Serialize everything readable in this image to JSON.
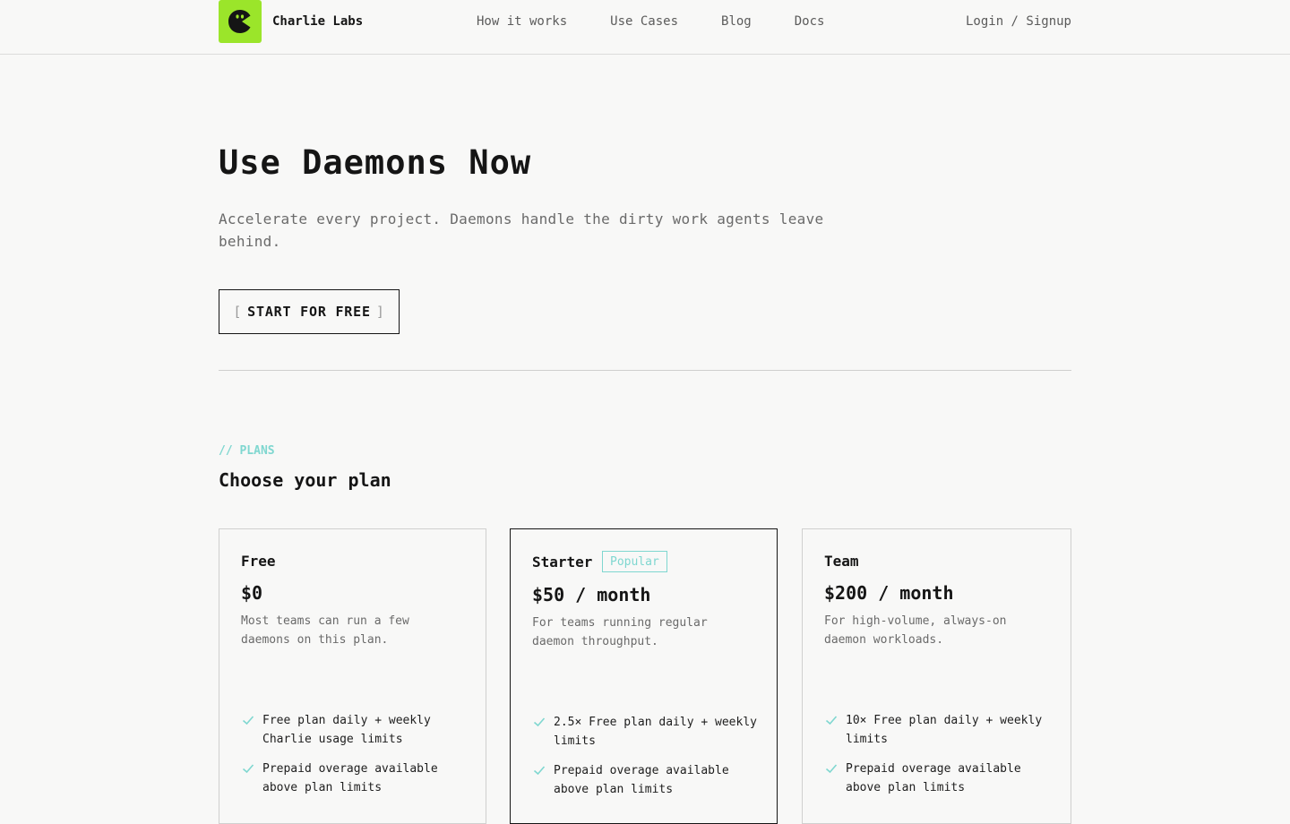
{
  "header": {
    "brand": "Charlie Labs",
    "logo_icon": "charlie-mascot-icon",
    "accent": "#9be52a",
    "nav": [
      "How it works",
      "Use Cases",
      "Blog",
      "Docs"
    ],
    "auth_link": "Login / Signup"
  },
  "hero": {
    "title": "Use Daemons Now",
    "subtitle": "Accelerate every project. Daemons handle the dirty work agents leave behind.",
    "cta_label": "START FOR FREE",
    "cta_bracket_open": "[",
    "cta_bracket_close": "]"
  },
  "plans": {
    "kicker": "// PLANS",
    "title": "Choose your plan",
    "highlight_color": "#7fd7d0",
    "cards": [
      {
        "name": "Free",
        "price": "$0",
        "description": "Most teams can run a few daemons on this plan.",
        "features": [
          "Free plan daily + weekly Charlie usage limits",
          "Prepaid overage available above plan limits"
        ]
      },
      {
        "name": "Starter",
        "badge": "Popular",
        "price": "$50 / month",
        "description": "For teams running regular daemon throughput.",
        "features": [
          "2.5× Free plan daily + weekly limits",
          "Prepaid overage available above plan limits"
        ]
      },
      {
        "name": "Team",
        "price": "$200 / month",
        "description": "For high-volume, always-on daemon workloads.",
        "features": [
          "10× Free plan daily + weekly limits",
          "Prepaid overage available above plan limits"
        ]
      }
    ]
  }
}
